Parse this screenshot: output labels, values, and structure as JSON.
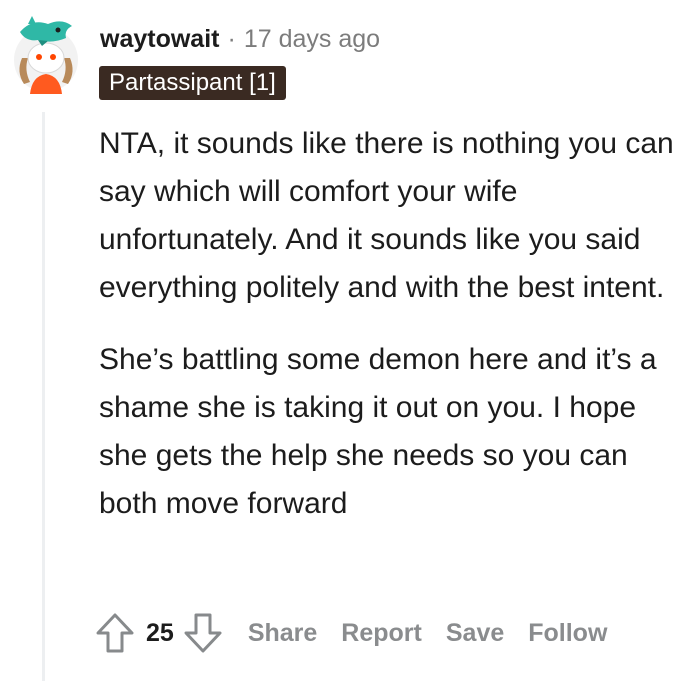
{
  "comment": {
    "author": "waytowait",
    "separator": "·",
    "timestamp": "17 days ago",
    "flair": "Partassipant [1]",
    "paragraphs": [
      "NTA, it sounds like there is nothing you can say which will comfort your wife unfortunately. And it sounds like you said everything politely and with the best intent.",
      "She’s battling some demon here and it’s a shame she is taking it out on you. I hope she gets the help she needs so you can both move forward"
    ]
  },
  "actions": {
    "score": "25",
    "share_label": "Share",
    "report_label": "Report",
    "save_label": "Save",
    "follow_label": "Follow"
  },
  "icons": {
    "avatar": "reddit-snoo-avatar",
    "upvote": "arrow-up-icon",
    "downvote": "arrow-down-icon"
  },
  "colors": {
    "flair_bg": "#3a2a22",
    "muted_text": "#7c7c7c",
    "action_text": "#8a8c8e",
    "avatar_accent": "#2fb8a6",
    "avatar_shirt": "#ff5a1f"
  }
}
